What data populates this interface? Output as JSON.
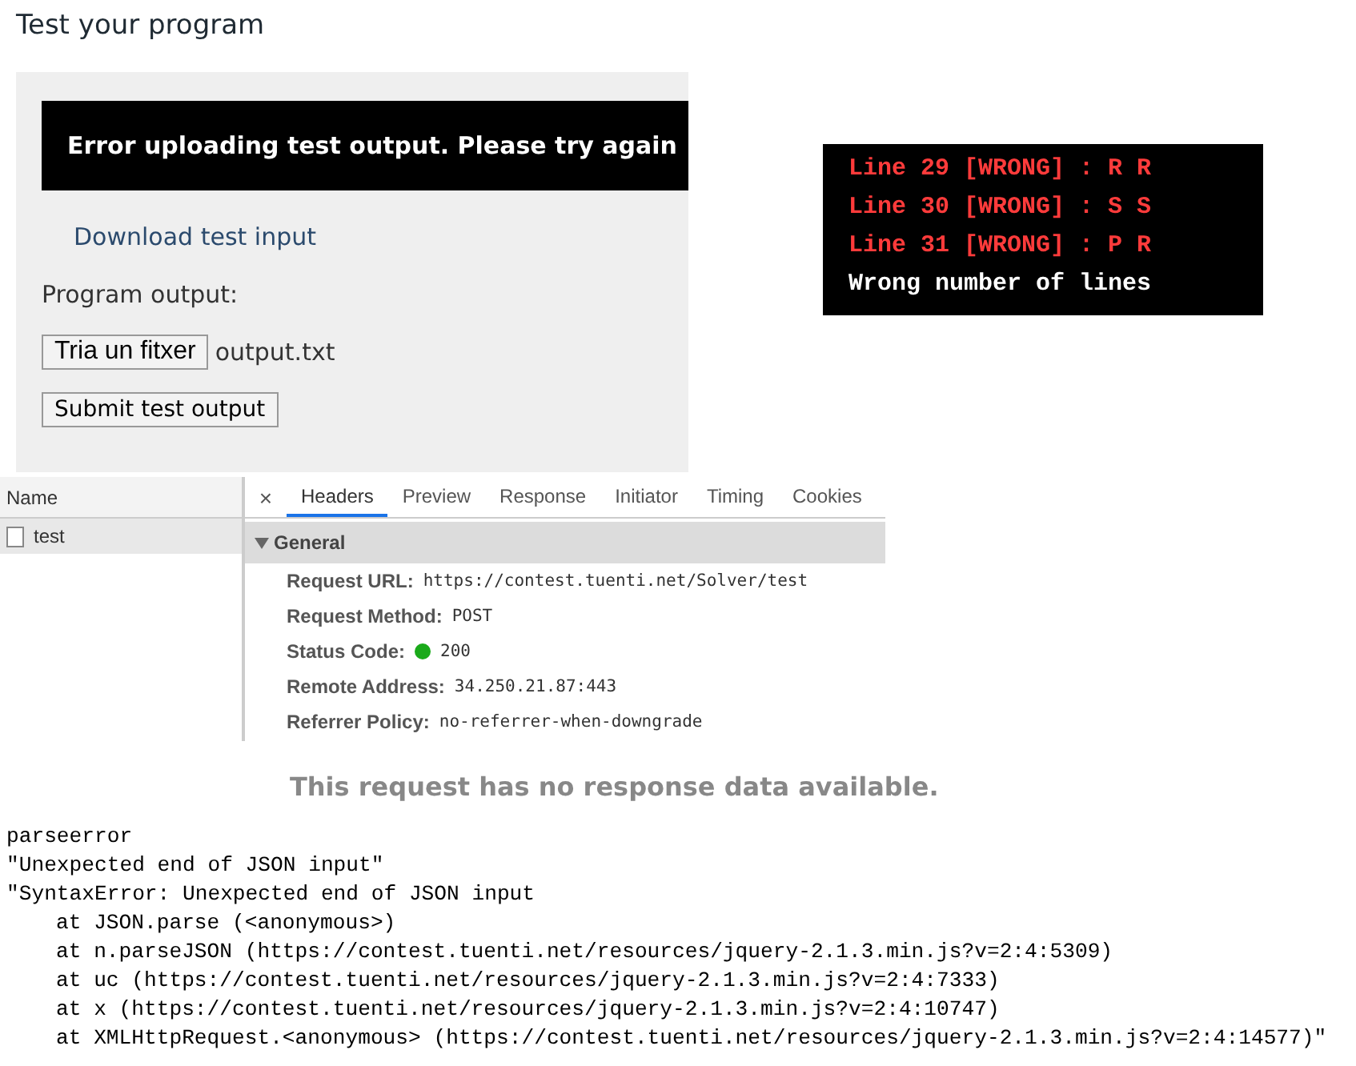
{
  "page_title": "Test your program",
  "form": {
    "error_banner": "Error uploading test output. Please try again",
    "download_link": "Download test input",
    "output_label": "Program output:",
    "file_button": "Tria un fitxer",
    "file_name": "output.txt",
    "submit_button": "Submit test output"
  },
  "terminal": {
    "lines": [
      {
        "text": "Line 29 [WRONG] : R R",
        "kind": "wrong"
      },
      {
        "text": "Line 30 [WRONG] : S S",
        "kind": "wrong"
      },
      {
        "text": "Line 31 [WRONG] : P R",
        "kind": "wrong"
      },
      {
        "text": "Wrong number of lines",
        "kind": "summary"
      }
    ]
  },
  "devtools": {
    "name_column": "Name",
    "requests": [
      {
        "name": "test",
        "selected": true
      }
    ],
    "close": "×",
    "tabs": [
      {
        "label": "Headers",
        "selected": true
      },
      {
        "label": "Preview",
        "selected": false
      },
      {
        "label": "Response",
        "selected": false
      },
      {
        "label": "Initiator",
        "selected": false
      },
      {
        "label": "Timing",
        "selected": false
      },
      {
        "label": "Cookies",
        "selected": false
      }
    ],
    "section": {
      "title": "General",
      "expanded": true,
      "rows": [
        {
          "key": "Request URL:",
          "value": "https://contest.tuenti.net/Solver/test"
        },
        {
          "key": "Request Method:",
          "value": "POST"
        },
        {
          "key": "Status Code:",
          "value": "200",
          "color": "#1aaa1a"
        },
        {
          "key": "Remote Address:",
          "value": "34.250.21.87:443"
        },
        {
          "key": "Referrer Policy:",
          "value": "no-referrer-when-downgrade"
        }
      ]
    }
  },
  "no_response_message": "This request has no response data available.",
  "console_log": [
    {
      "text": "parseerror",
      "indented": false
    },
    {
      "text": "\"Unexpected end of JSON input\"",
      "indented": false
    },
    {
      "text": "\"SyntaxError: Unexpected end of JSON input",
      "indented": false
    },
    {
      "text": "at JSON.parse (<anonymous>)",
      "indented": true
    },
    {
      "text": "at n.parseJSON (https://contest.tuenti.net/resources/jquery-2.1.3.min.js?v=2:4:5309)",
      "indented": true
    },
    {
      "text": "at uc (https://contest.tuenti.net/resources/jquery-2.1.3.min.js?v=2:4:7333)",
      "indented": true
    },
    {
      "text": "at x (https://contest.tuenti.net/resources/jquery-2.1.3.min.js?v=2:4:10747)",
      "indented": true
    },
    {
      "text": "at XMLHttpRequest.<anonymous> (https://contest.tuenti.net/resources/jquery-2.1.3.min.js?v=2:4:14577)\"",
      "indented": true
    }
  ]
}
